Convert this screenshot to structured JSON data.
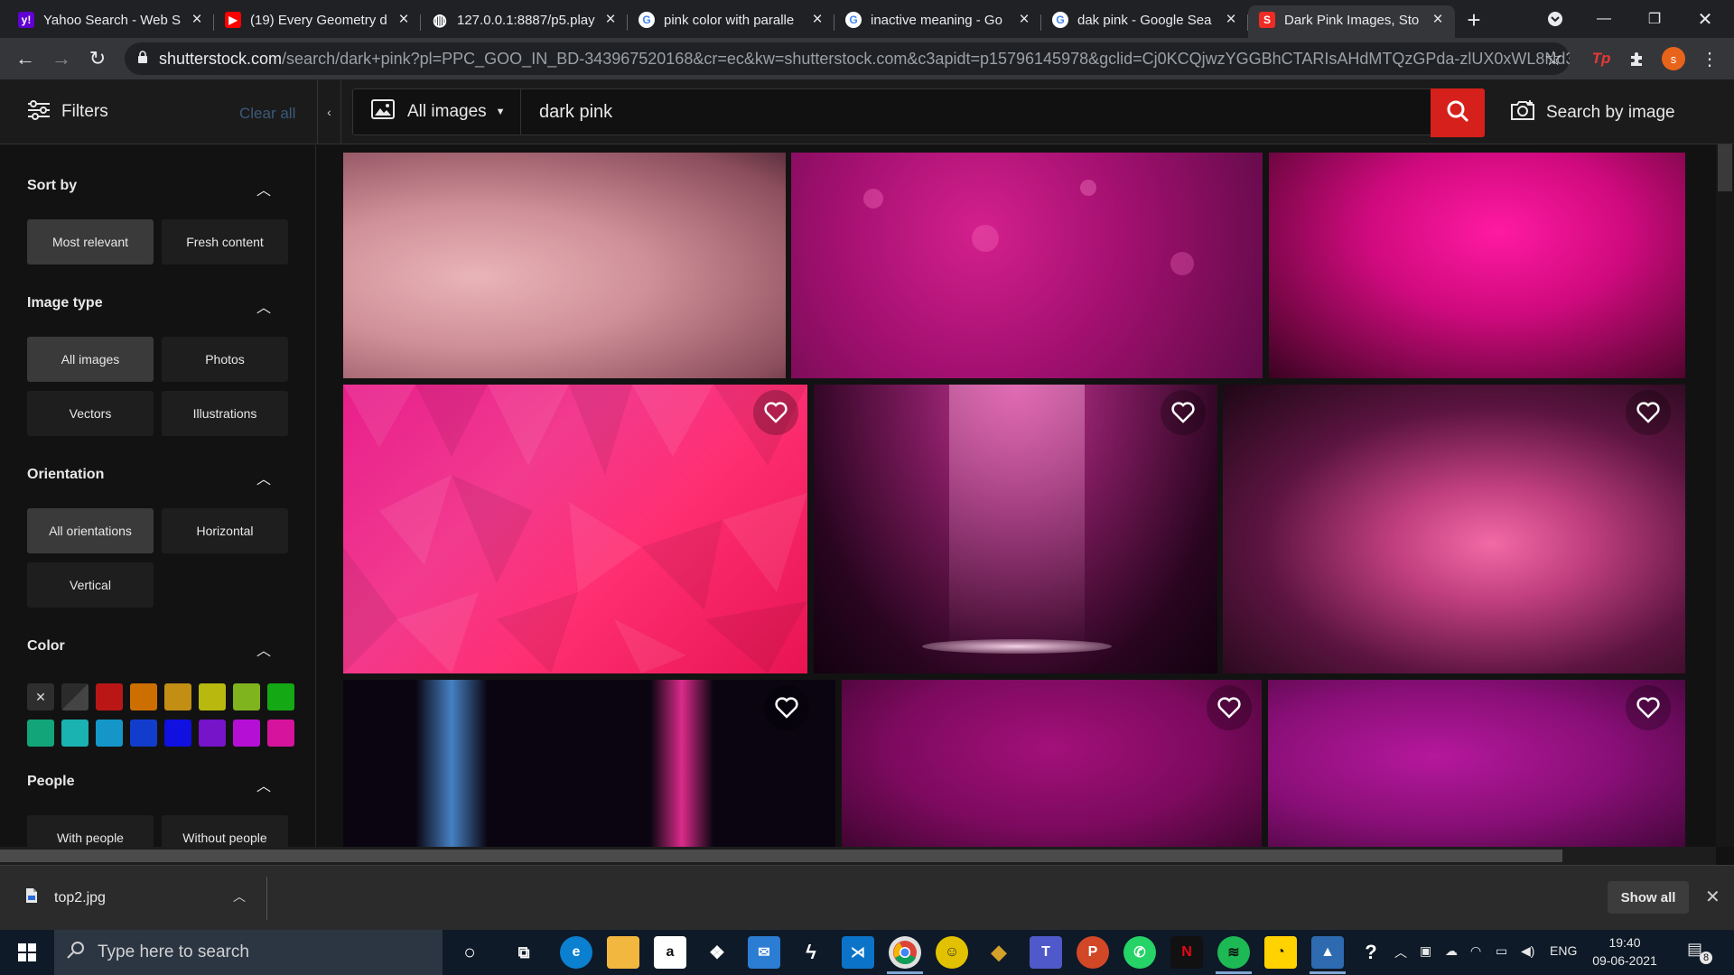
{
  "browser": {
    "tabs": [
      {
        "title": "Yahoo Search - Web S",
        "icon": "yahoo-icon",
        "color": "#6001d2",
        "glyph": "y!"
      },
      {
        "title": "(19) Every Geometry d",
        "icon": "youtube-icon",
        "color": "#ff0000",
        "glyph": "▶"
      },
      {
        "title": "127.0.0.1:8887/p5.play",
        "icon": "globe-icon",
        "color": "#5f6368",
        "glyph": "◍"
      },
      {
        "title": "pink color with paralle",
        "icon": "google-icon",
        "color": "#ffffff",
        "glyph": "G"
      },
      {
        "title": "inactive meaning - Go",
        "icon": "google-icon",
        "color": "#ffffff",
        "glyph": "G"
      },
      {
        "title": "dak pink - Google Sea",
        "icon": "google-icon",
        "color": "#ffffff",
        "glyph": "G"
      },
      {
        "title": "Dark Pink Images, Sto",
        "icon": "shutterstock-icon",
        "color": "#ee2b24",
        "glyph": "S",
        "active": true
      }
    ],
    "url_host": "shutterstock.com",
    "url_rest": "/search/dark+pink?pl=PPC_GOO_IN_BD-343967520168&cr=ec&kw=shutterstock.com&c3apidt=p15796145978&gclid=Cj0KCQjwzYGGBhCTARIsAHdMTQzGPda-zlUX0xWL8Nd3O...",
    "profile_initial": "s"
  },
  "header": {
    "filters_label": "Filters",
    "clear_all": "Clear all",
    "image_type": "All images",
    "search_query": "dark pink",
    "search_by_image": "Search by image"
  },
  "sidebar": {
    "sort_by": {
      "title": "Sort by",
      "options": [
        "Most relevant",
        "Fresh content"
      ]
    },
    "image_type": {
      "title": "Image type",
      "options": [
        "All images",
        "Photos",
        "Vectors",
        "Illustrations"
      ]
    },
    "orientation": {
      "title": "Orientation",
      "options": [
        "All orientations",
        "Horizontal",
        "Vertical"
      ]
    },
    "color": {
      "title": "Color",
      "clear_glyph": "✕"
    },
    "people": {
      "title": "People",
      "options": [
        "With people",
        "Without people"
      ]
    }
  },
  "swatches_row1": [
    "#2b2b2b",
    "#bb1616",
    "#cc6f00",
    "#c28e13",
    "#b8b80f",
    "#7fb41e",
    "#14a814"
  ],
  "swatches_row2": [
    "#12a57a",
    "#1bb2b2",
    "#1596c9",
    "#123dcc",
    "#1010e0",
    "#7514c9",
    "#b50fd6",
    "#d6139c"
  ],
  "downloads": {
    "file": "top2.jpg",
    "show_all": "Show all"
  },
  "taskbar": {
    "search_placeholder": "Type here to search",
    "language": "ENG",
    "time": "19:40",
    "date": "09-06-2021",
    "notification_count": "8"
  }
}
